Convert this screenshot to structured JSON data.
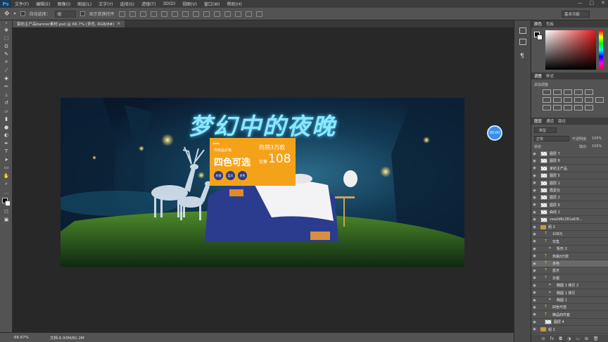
{
  "app": {
    "logo": "Ps"
  },
  "menu": [
    "文件(F)",
    "编辑(E)",
    "图像(I)",
    "图层(L)",
    "文字(Y)",
    "选择(S)",
    "滤镜(T)",
    "3D(D)",
    "视图(V)",
    "窗口(W)",
    "帮助(H)"
  ],
  "window_controls": [
    "—",
    "□",
    "✕"
  ],
  "options": {
    "auto_select_label": "自动选择：",
    "auto_select_value": "组",
    "show_transform_label": "显示变换控件",
    "workspace": "基本功能"
  },
  "document": {
    "tab_title": "家纺主产品banner素材.psd @ 66.7% (多色, RGB/8#)",
    "tab_close": "×"
  },
  "banner": {
    "title": "梦幻中的夜晚",
    "promo_prefix": "一",
    "promo_small": "件床品价格",
    "hot_sale": "热销3万款",
    "four_colors": "四色可选",
    "only_label": "仅售",
    "price": "108",
    "chips": [
      "灰银",
      "蓝天",
      "多色"
    ]
  },
  "float_badge": "00:00",
  "status": {
    "zoom": "66.67%",
    "doc_size": "文档:6.93M/81.2M"
  },
  "panels": {
    "color_tabs": [
      "颜色",
      "色板"
    ],
    "adjust_tabs": [
      "调整",
      "样式"
    ],
    "adjust_add_label": "添加调整",
    "layers_tabs": [
      "图层",
      "通道",
      "路径"
    ],
    "kind_label": "类型",
    "blend_mode": "正常",
    "opacity_label": "不透明度:",
    "opacity_value": "100%",
    "lock_label": "锁定:",
    "fill_label": "填充:",
    "fill_value": "100%"
  },
  "layers": [
    {
      "name": "图层 7",
      "type": "image",
      "indent": 0
    },
    {
      "name": "图层 8",
      "type": "image",
      "indent": 0
    },
    {
      "name": "家纺主产品",
      "type": "image",
      "indent": 0
    },
    {
      "name": "图层 5",
      "type": "image",
      "indent": 0
    },
    {
      "name": "图层 1",
      "type": "image",
      "indent": 0
    },
    {
      "name": "霞星社",
      "type": "image",
      "indent": 0
    },
    {
      "name": "图层 2",
      "type": "image",
      "indent": 0
    },
    {
      "name": "图层 6",
      "type": "image",
      "indent": 0
    },
    {
      "name": "曲线 1",
      "type": "image",
      "indent": 0
    },
    {
      "name": "cea2d6c281a63f...",
      "type": "image",
      "indent": 0
    },
    {
      "name": "组 2",
      "type": "group",
      "indent": 0
    },
    {
      "name": "108元",
      "type": "fx",
      "indent": 1
    },
    {
      "name": "仅售",
      "type": "fx",
      "indent": 1
    },
    {
      "name": "矩形 2",
      "type": "shape",
      "indent": 2
    },
    {
      "name": "热销3万款",
      "type": "fx",
      "indent": 1
    },
    {
      "name": "多色",
      "type": "fx",
      "indent": 1,
      "selected": true
    },
    {
      "name": "蓝天",
      "type": "fx",
      "indent": 1
    },
    {
      "name": "灰银",
      "type": "fx",
      "indent": 1
    },
    {
      "name": "椭圆 1 拷贝 2",
      "type": "shape",
      "indent": 2
    },
    {
      "name": "椭圆 1 拷贝",
      "type": "shape",
      "indent": 2
    },
    {
      "name": "椭圆 1",
      "type": "shape",
      "indent": 2
    },
    {
      "name": "四色可选",
      "type": "fx",
      "indent": 1
    },
    {
      "name": "精品四件套",
      "type": "fx",
      "indent": 1
    },
    {
      "name": "图层 4",
      "type": "image",
      "indent": 1
    },
    {
      "name": "组 1",
      "type": "group",
      "indent": 0
    }
  ]
}
